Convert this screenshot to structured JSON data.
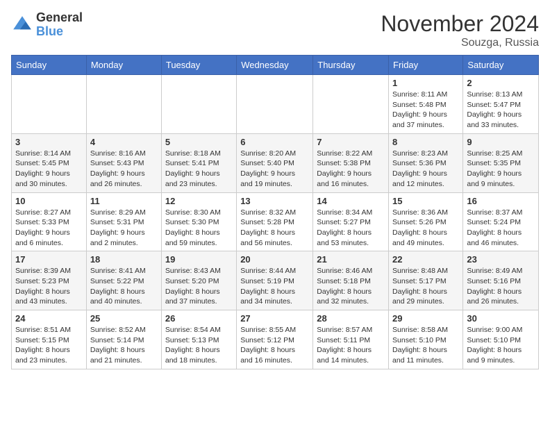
{
  "header": {
    "logo_line1": "General",
    "logo_line2": "Blue",
    "month_year": "November 2024",
    "location": "Souzga, Russia"
  },
  "weekdays": [
    "Sunday",
    "Monday",
    "Tuesday",
    "Wednesday",
    "Thursday",
    "Friday",
    "Saturday"
  ],
  "weeks": [
    [
      {
        "day": "",
        "info": ""
      },
      {
        "day": "",
        "info": ""
      },
      {
        "day": "",
        "info": ""
      },
      {
        "day": "",
        "info": ""
      },
      {
        "day": "",
        "info": ""
      },
      {
        "day": "1",
        "info": "Sunrise: 8:11 AM\nSunset: 5:48 PM\nDaylight: 9 hours and 37 minutes."
      },
      {
        "day": "2",
        "info": "Sunrise: 8:13 AM\nSunset: 5:47 PM\nDaylight: 9 hours and 33 minutes."
      }
    ],
    [
      {
        "day": "3",
        "info": "Sunrise: 8:14 AM\nSunset: 5:45 PM\nDaylight: 9 hours and 30 minutes."
      },
      {
        "day": "4",
        "info": "Sunrise: 8:16 AM\nSunset: 5:43 PM\nDaylight: 9 hours and 26 minutes."
      },
      {
        "day": "5",
        "info": "Sunrise: 8:18 AM\nSunset: 5:41 PM\nDaylight: 9 hours and 23 minutes."
      },
      {
        "day": "6",
        "info": "Sunrise: 8:20 AM\nSunset: 5:40 PM\nDaylight: 9 hours and 19 minutes."
      },
      {
        "day": "7",
        "info": "Sunrise: 8:22 AM\nSunset: 5:38 PM\nDaylight: 9 hours and 16 minutes."
      },
      {
        "day": "8",
        "info": "Sunrise: 8:23 AM\nSunset: 5:36 PM\nDaylight: 9 hours and 12 minutes."
      },
      {
        "day": "9",
        "info": "Sunrise: 8:25 AM\nSunset: 5:35 PM\nDaylight: 9 hours and 9 minutes."
      }
    ],
    [
      {
        "day": "10",
        "info": "Sunrise: 8:27 AM\nSunset: 5:33 PM\nDaylight: 9 hours and 6 minutes."
      },
      {
        "day": "11",
        "info": "Sunrise: 8:29 AM\nSunset: 5:31 PM\nDaylight: 9 hours and 2 minutes."
      },
      {
        "day": "12",
        "info": "Sunrise: 8:30 AM\nSunset: 5:30 PM\nDaylight: 8 hours and 59 minutes."
      },
      {
        "day": "13",
        "info": "Sunrise: 8:32 AM\nSunset: 5:28 PM\nDaylight: 8 hours and 56 minutes."
      },
      {
        "day": "14",
        "info": "Sunrise: 8:34 AM\nSunset: 5:27 PM\nDaylight: 8 hours and 53 minutes."
      },
      {
        "day": "15",
        "info": "Sunrise: 8:36 AM\nSunset: 5:26 PM\nDaylight: 8 hours and 49 minutes."
      },
      {
        "day": "16",
        "info": "Sunrise: 8:37 AM\nSunset: 5:24 PM\nDaylight: 8 hours and 46 minutes."
      }
    ],
    [
      {
        "day": "17",
        "info": "Sunrise: 8:39 AM\nSunset: 5:23 PM\nDaylight: 8 hours and 43 minutes."
      },
      {
        "day": "18",
        "info": "Sunrise: 8:41 AM\nSunset: 5:22 PM\nDaylight: 8 hours and 40 minutes."
      },
      {
        "day": "19",
        "info": "Sunrise: 8:43 AM\nSunset: 5:20 PM\nDaylight: 8 hours and 37 minutes."
      },
      {
        "day": "20",
        "info": "Sunrise: 8:44 AM\nSunset: 5:19 PM\nDaylight: 8 hours and 34 minutes."
      },
      {
        "day": "21",
        "info": "Sunrise: 8:46 AM\nSunset: 5:18 PM\nDaylight: 8 hours and 32 minutes."
      },
      {
        "day": "22",
        "info": "Sunrise: 8:48 AM\nSunset: 5:17 PM\nDaylight: 8 hours and 29 minutes."
      },
      {
        "day": "23",
        "info": "Sunrise: 8:49 AM\nSunset: 5:16 PM\nDaylight: 8 hours and 26 minutes."
      }
    ],
    [
      {
        "day": "24",
        "info": "Sunrise: 8:51 AM\nSunset: 5:15 PM\nDaylight: 8 hours and 23 minutes."
      },
      {
        "day": "25",
        "info": "Sunrise: 8:52 AM\nSunset: 5:14 PM\nDaylight: 8 hours and 21 minutes."
      },
      {
        "day": "26",
        "info": "Sunrise: 8:54 AM\nSunset: 5:13 PM\nDaylight: 8 hours and 18 minutes."
      },
      {
        "day": "27",
        "info": "Sunrise: 8:55 AM\nSunset: 5:12 PM\nDaylight: 8 hours and 16 minutes."
      },
      {
        "day": "28",
        "info": "Sunrise: 8:57 AM\nSunset: 5:11 PM\nDaylight: 8 hours and 14 minutes."
      },
      {
        "day": "29",
        "info": "Sunrise: 8:58 AM\nSunset: 5:10 PM\nDaylight: 8 hours and 11 minutes."
      },
      {
        "day": "30",
        "info": "Sunrise: 9:00 AM\nSunset: 5:10 PM\nDaylight: 8 hours and 9 minutes."
      }
    ]
  ]
}
